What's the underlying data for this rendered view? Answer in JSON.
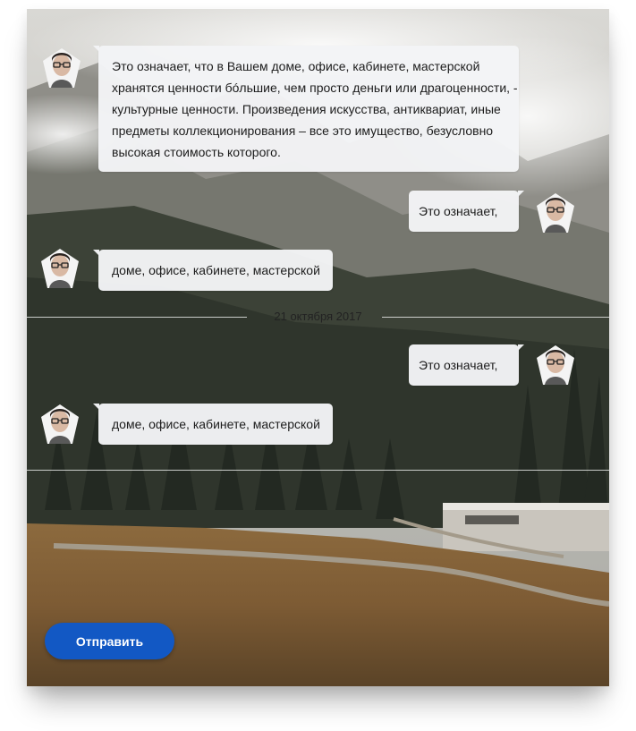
{
  "messages": [
    {
      "id": "m1",
      "side": "left",
      "text": "Это означает, что в Вашем доме, офисе, кабинете, мастерской хранятся ценности бóльшие, чем просто деньги или драгоценности, - культурные ценности. Произведения искусства, антиквариат, иные предметы коллекционирования – все это имущество, безусловно высокая стоимость которого."
    },
    {
      "id": "m2",
      "side": "right",
      "text": "Это означает,"
    },
    {
      "id": "m3",
      "side": "left",
      "text": "доме, офисе, кабинете, мастерской"
    },
    {
      "id": "m4",
      "side": "right",
      "text": "Это означает,"
    },
    {
      "id": "m5",
      "side": "left",
      "text": "доме, офисе, кабинете, мастерской"
    }
  ],
  "date_separator": "21 октября 2017",
  "send_button": "Отправить",
  "colors": {
    "accent": "#1258c4",
    "bubble": "#f3f4f6"
  },
  "icons": {
    "avatar": "user-avatar-icon"
  }
}
